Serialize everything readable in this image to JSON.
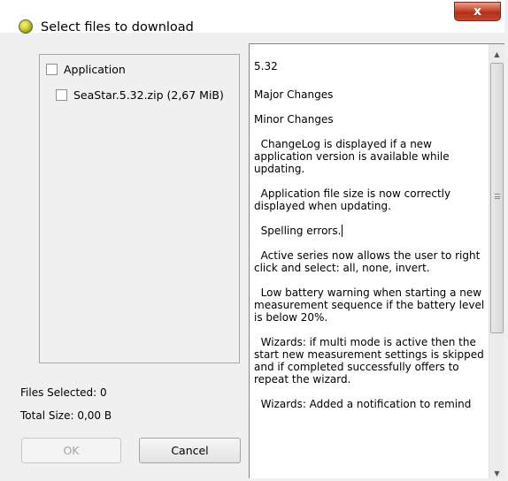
{
  "window": {
    "title": "Select files to download",
    "close_label": "x",
    "icon": "app-orb-icon"
  },
  "tree": {
    "items": [
      {
        "label": "Application",
        "checked": false,
        "level": 0
      },
      {
        "label": "SeaStar.5.32.zip (2,67 MiB)",
        "checked": false,
        "level": 1
      }
    ]
  },
  "status": {
    "files_selected": "Files Selected: 0",
    "total_size": "Total Size: 0,00 B"
  },
  "buttons": {
    "ok": "OK",
    "cancel": "Cancel"
  },
  "changelog": {
    "version": "5.32",
    "major": "Major Changes",
    "minor": "Minor Changes",
    "entries": [
      "ChangeLog is displayed if a new application version is available while updating.",
      "Application file size is now correctly displayed when updating.",
      "Spelling errors.",
      "Active series now allows the user to right click and select: all, none, invert.",
      "Low battery warning when starting a new measurement sequence if the battery level is below 20%.",
      "Wizards: if multi mode is active then the start new measurement settings is skipped and if completed successfully offers to repeat the wizard.",
      "Wizards: Added a notification to remind"
    ]
  }
}
